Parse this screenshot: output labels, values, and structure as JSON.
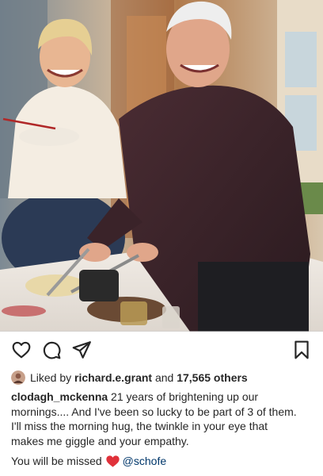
{
  "post": {
    "image_alt": "Two people laughing at a kitchen counter during a TV segment",
    "actions": {
      "like_icon": "heart-outline-icon",
      "comment_icon": "comment-bubble-icon",
      "share_icon": "paper-plane-icon",
      "save_icon": "bookmark-icon"
    },
    "likes": {
      "prefix": "Liked by",
      "user": "richard.e.grant",
      "conjunction": "and",
      "count": "17,565 others"
    },
    "caption": {
      "author": "clodagh_mckenna",
      "line1_text": "21 years of brightening up our",
      "line2": "mornings.... And I've been so lucky to be part of 3 of them.",
      "line3": "I'll miss the morning hug, the twinkle in your eye that",
      "line4": "makes me giggle and your empathy."
    },
    "signoff": {
      "text": "You will be missed",
      "emoji": "red-heart",
      "mention": "@schofe"
    }
  },
  "colors": {
    "text": "#262626",
    "mention": "#00376b",
    "heart_emoji": "#e0313a"
  }
}
